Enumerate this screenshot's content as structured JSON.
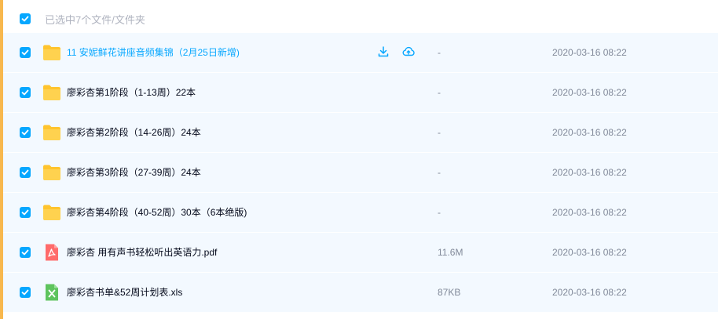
{
  "header": {
    "selection_text": "已选中7个文件/文件夹"
  },
  "colors": {
    "accent": "#06a7ff",
    "left_bar": "#f8b84e",
    "row_bg": "#f3f9ff",
    "folder": "#ffc42e",
    "pdf": "#ff6b6b",
    "xls": "#5ec45e"
  },
  "files": [
    {
      "icon": "folder-icon",
      "name": "11 安妮鲜花讲座音频集锦（2月25日新增)",
      "size": "-",
      "date": "2020-03-16 08:22",
      "checked": true
    },
    {
      "icon": "folder-icon",
      "name": "廖彩杏第1阶段（1-13周）22本",
      "size": "-",
      "date": "2020-03-16 08:22",
      "checked": true
    },
    {
      "icon": "folder-icon",
      "name": "廖彩杏第2阶段（14-26周）24本",
      "size": "-",
      "date": "2020-03-16 08:22",
      "checked": true
    },
    {
      "icon": "folder-icon",
      "name": "廖彩杏第3阶段（27-39周）24本",
      "size": "-",
      "date": "2020-03-16 08:22",
      "checked": true
    },
    {
      "icon": "folder-icon",
      "name": "廖彩杏第4阶段（40-52周）30本（6本绝版)",
      "size": "-",
      "date": "2020-03-16 08:22",
      "checked": true
    },
    {
      "icon": "pdf-icon",
      "name": "廖彩杏 用有声书轻松听出英语力.pdf",
      "size": "11.6M",
      "date": "2020-03-16 08:22",
      "checked": true
    },
    {
      "icon": "xls-icon",
      "name": "廖彩杏书单&52周计划表.xls",
      "size": "87KB",
      "date": "2020-03-16 08:22",
      "checked": true
    }
  ],
  "row_actions": {
    "download": "download-icon",
    "save_to_cloud": "cloud-upload-icon"
  }
}
